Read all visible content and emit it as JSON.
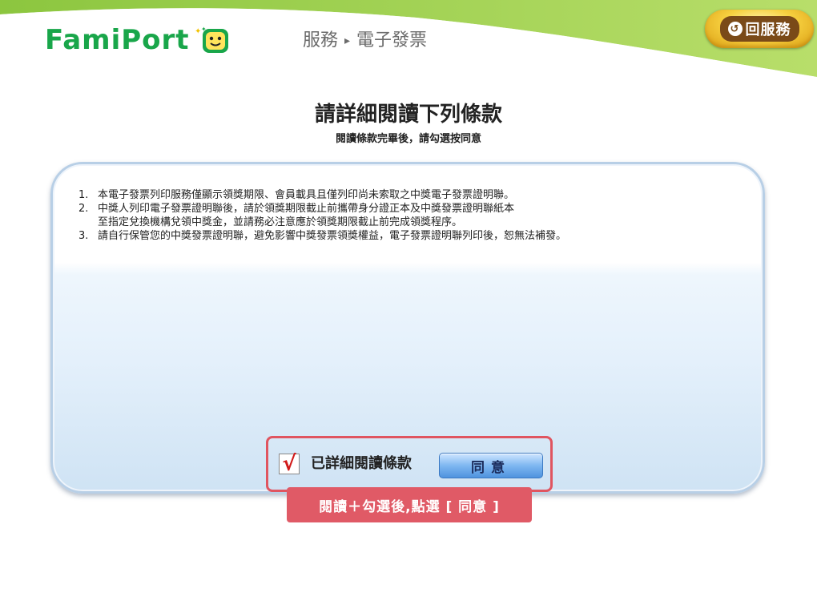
{
  "header": {
    "logo_text": "FamiPort",
    "breadcrumb": [
      "服務",
      "電子發票"
    ],
    "breadcrumb_sep": "▸",
    "back_button_label": "回服務"
  },
  "page": {
    "title": "請詳細閱讀下列條款",
    "subtitle": "閱讀條款完畢後，請勾選按同意"
  },
  "terms": [
    {
      "num": "1.",
      "lines": [
        "本電子發票列印服務僅顯示領獎期限、會員載具且僅列印尚未索取之中獎電子發票證明聯。"
      ]
    },
    {
      "num": "2.",
      "lines": [
        "中獎人列印電子發票證明聯後，請於領獎期限截止前攜帶身分證正本及中獎發票證明聯紙本",
        "至指定兌換機構兌領中獎金，並請務必注意應於領獎期限截止前完成領獎程序。"
      ]
    },
    {
      "num": "3.",
      "lines": [
        "請自行保管您的中獎發票證明聯，避免影響中獎發票領獎權益，電子發票證明聯列印後，恕無法補發。"
      ]
    }
  ],
  "agree": {
    "checkbox_checked": true,
    "checkbox_mark": "√",
    "label": "已詳細閱讀條款",
    "button_label": "同意",
    "hint": "閱讀＋勾選後,點選 [ 同意 ]"
  },
  "colors": {
    "brand_green": "#19a64a",
    "header_swoosh": "#a9d65a",
    "highlight_red": "#e05560",
    "button_blue": "#4f93de",
    "back_button_gold": "#f7d140"
  }
}
